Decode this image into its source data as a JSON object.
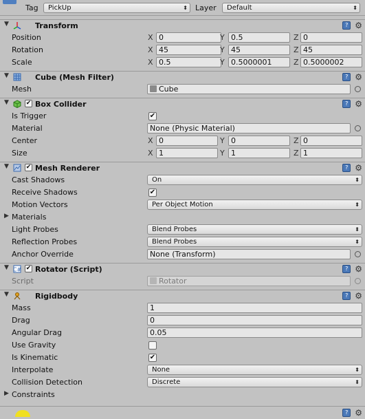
{
  "topbar": {
    "tag_label": "Tag",
    "tag_value": "PickUp",
    "layer_label": "Layer",
    "layer_value": "Default"
  },
  "transform": {
    "title": "Transform",
    "position": {
      "label": "Position",
      "x": "0",
      "y": "0.5",
      "z": "0"
    },
    "rotation": {
      "label": "Rotation",
      "x": "45",
      "y": "45",
      "z": "45"
    },
    "scale": {
      "label": "Scale",
      "x": "0.5",
      "y": "0.5000001",
      "z": "0.5000002"
    }
  },
  "mesh_filter": {
    "title": "Cube (Mesh Filter)",
    "mesh_label": "Mesh",
    "mesh_value": "Cube"
  },
  "box_collider": {
    "title": "Box Collider",
    "is_trigger_label": "Is Trigger",
    "material_label": "Material",
    "material_value": "None (Physic Material)",
    "center": {
      "label": "Center",
      "x": "0",
      "y": "0",
      "z": "0"
    },
    "size": {
      "label": "Size",
      "x": "1",
      "y": "1",
      "z": "1"
    }
  },
  "mesh_renderer": {
    "title": "Mesh Renderer",
    "cast_shadows_label": "Cast Shadows",
    "cast_shadows_value": "On",
    "receive_shadows_label": "Receive Shadows",
    "motion_vectors_label": "Motion Vectors",
    "motion_vectors_value": "Per Object Motion",
    "materials_label": "Materials",
    "light_probes_label": "Light Probes",
    "light_probes_value": "Blend Probes",
    "reflection_probes_label": "Reflection Probes",
    "reflection_probes_value": "Blend Probes",
    "anchor_override_label": "Anchor Override",
    "anchor_override_value": "None (Transform)"
  },
  "rotator": {
    "title": "Rotator (Script)",
    "script_label": "Script",
    "script_value": "Rotator"
  },
  "rigidbody": {
    "title": "Rigidbody",
    "mass_label": "Mass",
    "mass_value": "1",
    "drag_label": "Drag",
    "drag_value": "0",
    "angular_drag_label": "Angular Drag",
    "angular_drag_value": "0.05",
    "use_gravity_label": "Use Gravity",
    "is_kinematic_label": "Is Kinematic",
    "interpolate_label": "Interpolate",
    "interpolate_value": "None",
    "collision_label": "Collision Detection",
    "collision_value": "Discrete",
    "constraints_label": "Constraints"
  },
  "axes": {
    "x": "X",
    "y": "Y",
    "z": "Z"
  }
}
